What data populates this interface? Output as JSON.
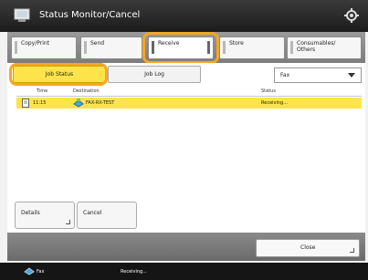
{
  "window": {
    "title": "Status Monitor/Cancel"
  },
  "tabs": [
    {
      "label": "Copy/Print",
      "active": false
    },
    {
      "label": "Send",
      "active": false
    },
    {
      "label": "Receive",
      "active": true
    },
    {
      "label": "Store",
      "active": false
    },
    {
      "label": "Consumables/\nOthers",
      "active": false
    }
  ],
  "subtabs": [
    {
      "label": "Job Status",
      "active": true
    },
    {
      "label": "Job Log",
      "active": false
    }
  ],
  "filter": {
    "selected": "Fax"
  },
  "table": {
    "columns": [
      "Time",
      "Destination",
      "Status"
    ],
    "rows": [
      {
        "time": "11:15",
        "destination": "FAX-RX-TEST",
        "status": "Receiving..."
      }
    ]
  },
  "buttons": {
    "details": "Details",
    "cancel": "Cancel",
    "close": "Close"
  },
  "statusbar": {
    "job_type": "Fax",
    "message": "Receiving..."
  },
  "colors": {
    "highlight": "#f5a623",
    "selection": "#fde44a"
  },
  "icons": [
    "status-monitor-icon",
    "gear-icon",
    "document-icon",
    "fax-icon",
    "chevron-down-icon"
  ]
}
